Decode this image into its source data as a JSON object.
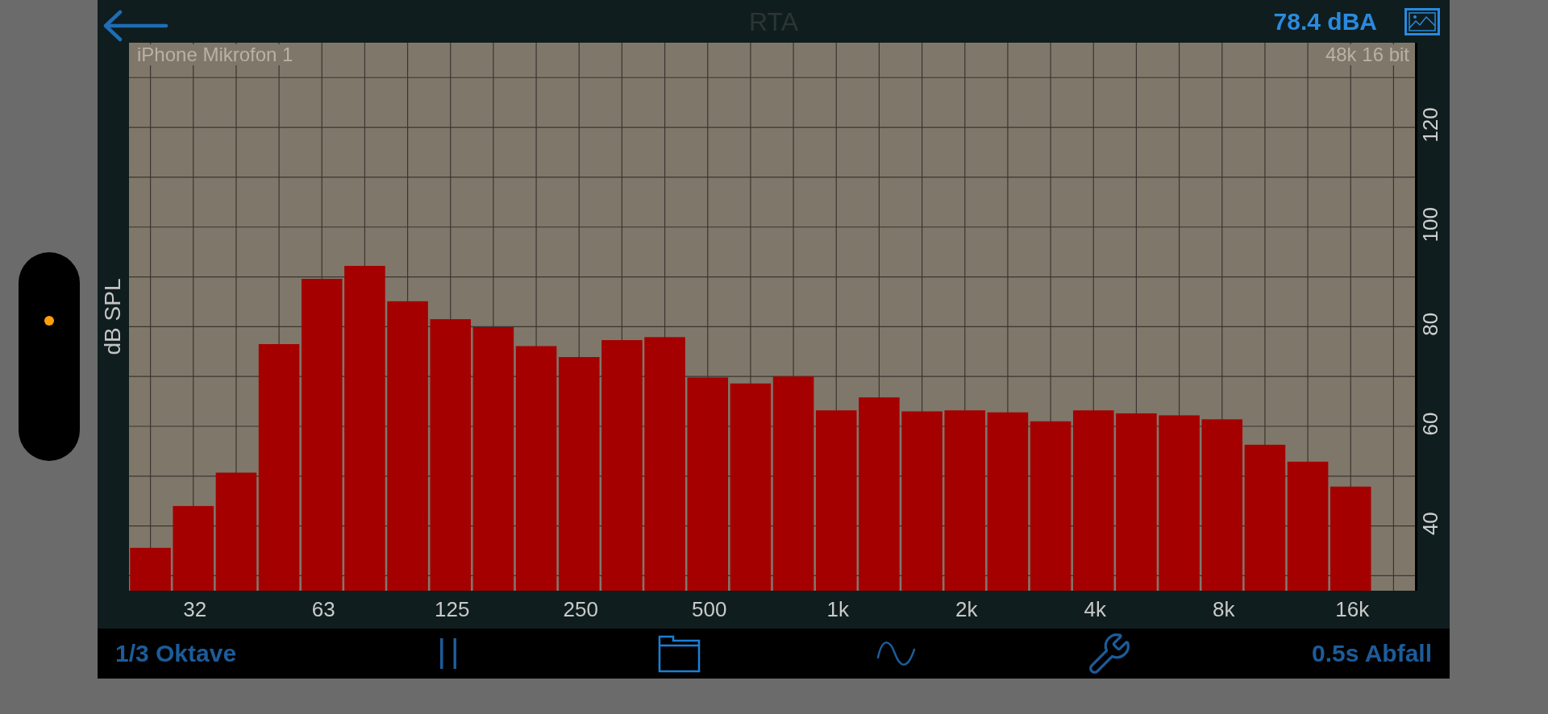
{
  "top_bar": {
    "title": "RTA",
    "level_reading": "78.4 dBA"
  },
  "chart": {
    "input_label": "iPhone Mikrofon 1",
    "format_label": "48k 16 bit",
    "chart_data": {
      "type": "bar",
      "ylabel": "dB SPL",
      "categories": [
        null,
        "32",
        null,
        null,
        "63",
        null,
        null,
        "125",
        null,
        null,
        "250",
        null,
        null,
        "500",
        null,
        null,
        "1k",
        null,
        null,
        "2k",
        null,
        null,
        "4k",
        null,
        null,
        "8k",
        null,
        null,
        "16k",
        null
      ],
      "values": [
        35.6,
        44.0,
        50.7,
        76.5,
        89.6,
        92.2,
        85.1,
        81.5,
        79.9,
        76.1,
        73.9,
        77.3,
        77.9,
        69.8,
        68.6,
        70.0,
        63.2,
        65.8,
        63.0,
        63.2,
        62.8,
        61.0,
        63.2,
        62.6,
        62.2,
        61.4,
        56.3,
        52.9,
        47.9,
        null
      ],
      "ylim": [
        27,
        137
      ],
      "yticks": [
        40,
        60,
        80,
        100,
        120
      ],
      "grid": true
    }
  },
  "bottom_bar": {
    "resolution": "1/3 Oktave",
    "decay": "0.5s Abfall"
  }
}
